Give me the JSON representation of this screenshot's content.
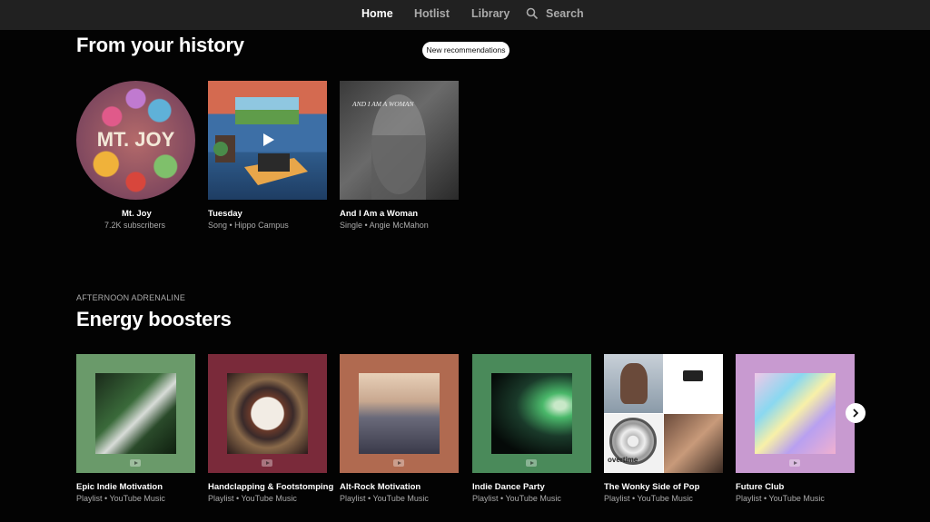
{
  "nav": {
    "home": "Home",
    "hotlist": "Hotlist",
    "library": "Library",
    "search": "Search"
  },
  "history": {
    "heading": "From your history",
    "new_recs": "New recommendations",
    "items": [
      {
        "title": "Mt. Joy",
        "subtitle": "7.2K subscribers",
        "art_text": "MT. JOY"
      },
      {
        "title": "Tuesday",
        "subtitle": "Song • Hippo Campus"
      },
      {
        "title": "And I Am a Woman",
        "subtitle": "Single • Angie McMahon",
        "art_text": "AND I AM A WOMAN"
      }
    ]
  },
  "energy": {
    "strapline": "AFTERNOON ADRENALINE",
    "heading": "Energy boosters",
    "items": [
      {
        "title": "Epic Indie Motivation",
        "subtitle": "Playlist • YouTube Music"
      },
      {
        "title": "Handclapping & Footstomping",
        "subtitle": "Playlist • YouTube Music"
      },
      {
        "title": "Alt-Rock Motivation",
        "subtitle": "Playlist • YouTube Music"
      },
      {
        "title": "Indie Dance Party",
        "subtitle": "Playlist • YouTube Music"
      },
      {
        "title": "The Wonky Side of Pop",
        "subtitle": "Playlist • YouTube Music",
        "art_text": "overtime"
      },
      {
        "title": "Future Club",
        "subtitle": "Playlist • YouTube Music"
      }
    ],
    "next_icon": "chevron-right-icon"
  }
}
